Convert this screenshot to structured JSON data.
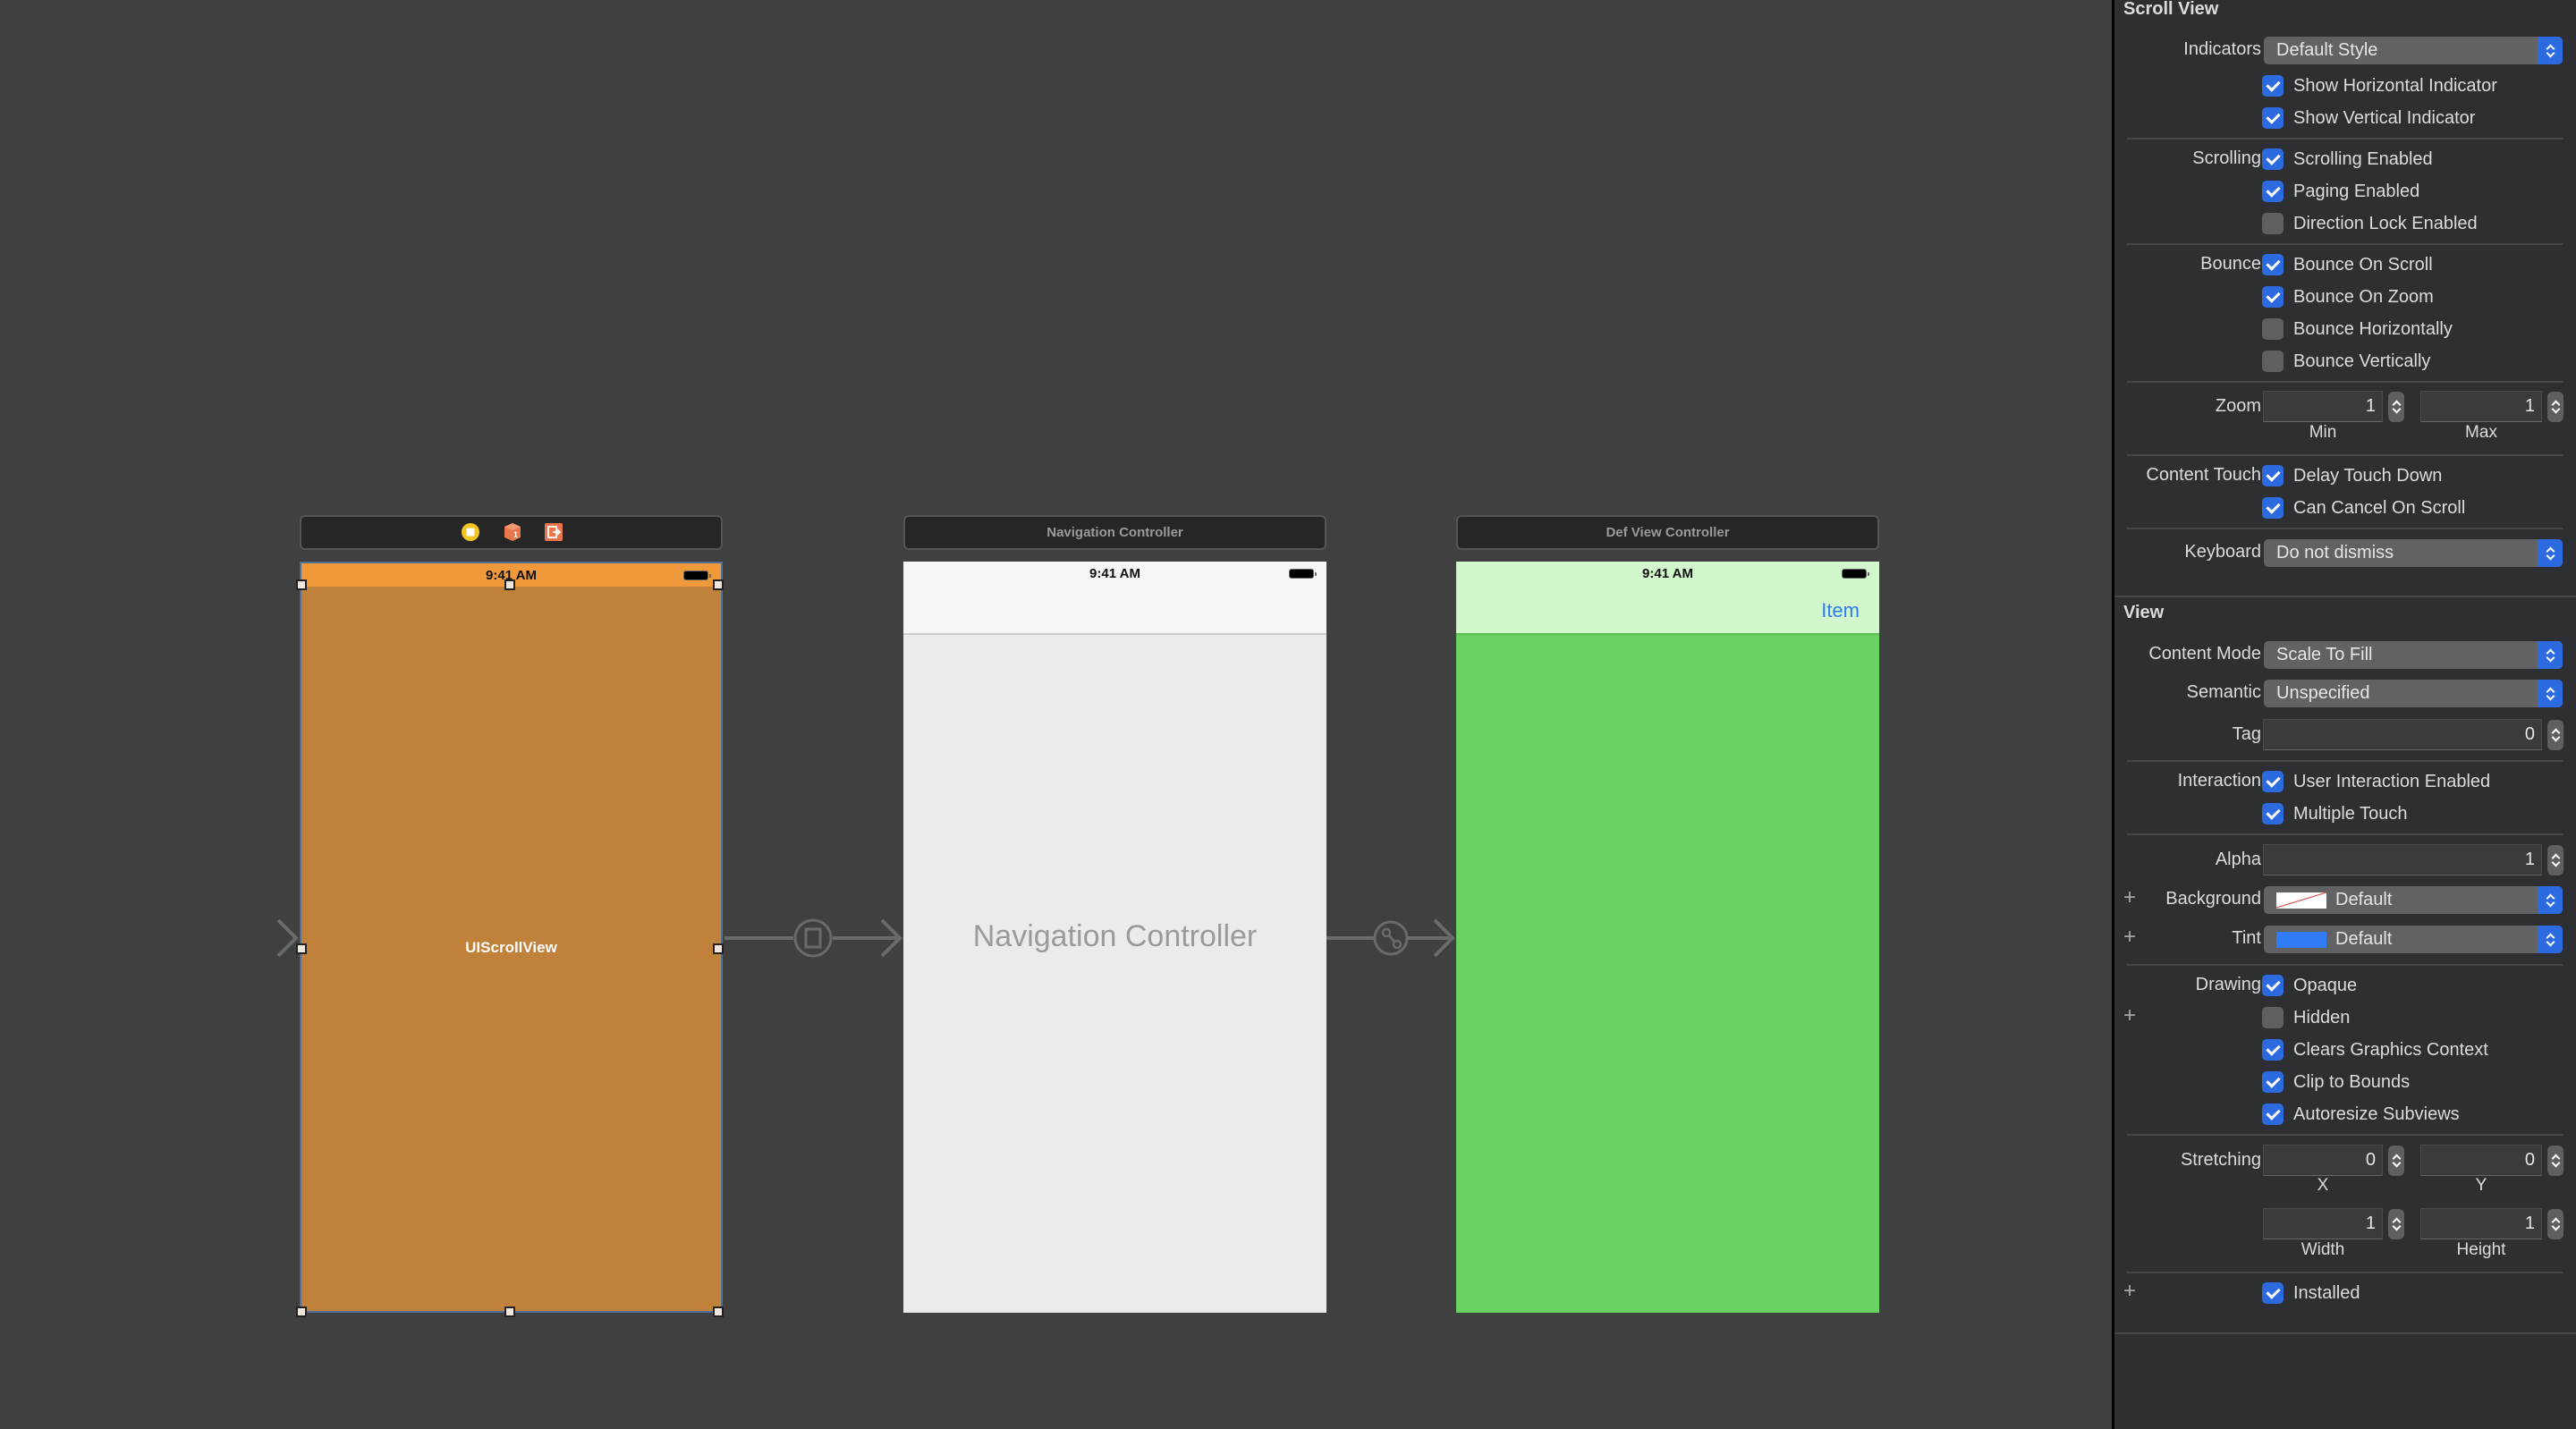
{
  "canvas": {
    "scenes": [
      {
        "name": "scroll-view-scene",
        "header_icons": [
          "view-controller-icon",
          "first-responder-icon",
          "exit-icon"
        ],
        "status_time": "9:41 AM",
        "content_label": "UIScrollView",
        "status_bar_color": "#f0993a",
        "body_color": "#c0813a",
        "selected": true
      },
      {
        "name": "navigation-controller-scene",
        "title": "Navigation Controller",
        "status_time": "9:41 AM",
        "content_label": "Navigation Controller",
        "body_color": "#ebebeb"
      },
      {
        "name": "def-view-controller-scene",
        "title": "Def View Controller",
        "status_time": "9:41 AM",
        "nav_item_label": "Item",
        "nav_color": "#d2f7cc",
        "body_color": "#6ad262"
      }
    ],
    "segues": [
      {
        "from": "entry",
        "to": "scroll-view-scene",
        "kind": "initial"
      },
      {
        "from": "scroll-view-scene",
        "to": "navigation-controller-scene",
        "kind": "present"
      },
      {
        "from": "navigation-controller-scene",
        "to": "def-view-controller-scene",
        "kind": "root-relationship"
      }
    ]
  },
  "inspector": {
    "scroll_view": {
      "title": "Scroll View",
      "indicators_label": "Indicators",
      "indicators_value": "Default Style",
      "show_horizontal": {
        "label": "Show Horizontal Indicator",
        "checked": true
      },
      "show_vertical": {
        "label": "Show Vertical Indicator",
        "checked": true
      },
      "scrolling_label": "Scrolling",
      "scrolling_enabled": {
        "label": "Scrolling Enabled",
        "checked": true
      },
      "paging_enabled": {
        "label": "Paging Enabled",
        "checked": true
      },
      "direction_lock": {
        "label": "Direction Lock Enabled",
        "checked": false
      },
      "bounce_label": "Bounce",
      "bounce_on_scroll": {
        "label": "Bounce On Scroll",
        "checked": true
      },
      "bounce_on_zoom": {
        "label": "Bounce On Zoom",
        "checked": true
      },
      "bounce_horizontally": {
        "label": "Bounce Horizontally",
        "checked": false
      },
      "bounce_vertically": {
        "label": "Bounce Vertically",
        "checked": false
      },
      "zoom_label": "Zoom",
      "zoom_min": "1",
      "zoom_min_label": "Min",
      "zoom_max": "1",
      "zoom_max_label": "Max",
      "content_touch_label": "Content Touch",
      "delay_touch_down": {
        "label": "Delay Touch Down",
        "checked": true
      },
      "can_cancel_on_scroll": {
        "label": "Can Cancel On Scroll",
        "checked": true
      },
      "keyboard_label": "Keyboard",
      "keyboard_value": "Do not dismiss"
    },
    "view": {
      "title": "View",
      "content_mode_label": "Content Mode",
      "content_mode_value": "Scale To Fill",
      "semantic_label": "Semantic",
      "semantic_value": "Unspecified",
      "tag_label": "Tag",
      "tag_value": "0",
      "interaction_label": "Interaction",
      "user_interaction": {
        "label": "User Interaction Enabled",
        "checked": true
      },
      "multiple_touch": {
        "label": "Multiple Touch",
        "checked": true
      },
      "alpha_label": "Alpha",
      "alpha_value": "1",
      "background_label": "Background",
      "background_value": "Default",
      "tint_label": "Tint",
      "tint_value": "Default",
      "tint_color": "#2f7cf6",
      "drawing_label": "Drawing",
      "opaque": {
        "label": "Opaque",
        "checked": true
      },
      "hidden": {
        "label": "Hidden",
        "checked": false
      },
      "clears_graphics": {
        "label": "Clears Graphics Context",
        "checked": true
      },
      "clip_to_bounds": {
        "label": "Clip to Bounds",
        "checked": true
      },
      "autoresize_subviews": {
        "label": "Autoresize Subviews",
        "checked": true
      },
      "stretching_label": "Stretching",
      "stretch_x": "0",
      "stretch_x_label": "X",
      "stretch_y": "0",
      "stretch_y_label": "Y",
      "stretch_width": "1",
      "stretch_width_label": "Width",
      "stretch_height": "1",
      "stretch_height_label": "Height",
      "installed": {
        "label": "Installed",
        "checked": true
      }
    }
  },
  "colors": {
    "accent": "#2c6ae0",
    "canvas_bg": "#404040",
    "inspector_bg": "#2e2f33"
  }
}
